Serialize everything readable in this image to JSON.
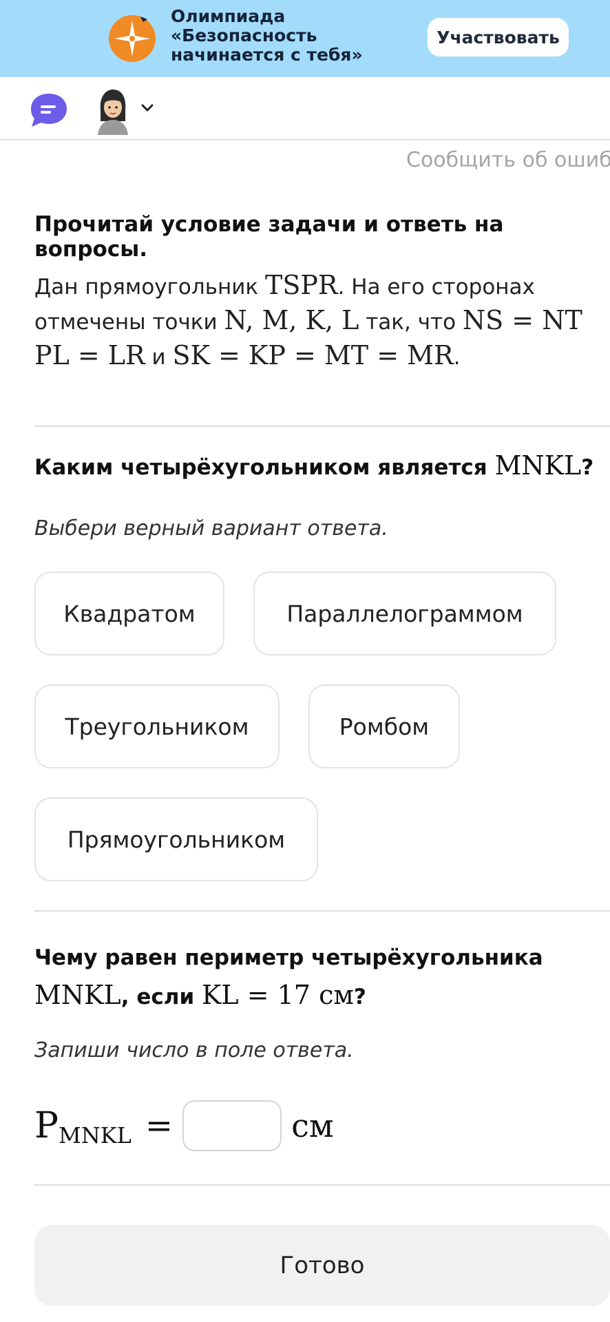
{
  "banner": {
    "title_lines": [
      "Олимпиада",
      "«Безопасность",
      "начинается с тебя»"
    ],
    "button_label": "Участвовать",
    "logo_icon": "compass-rose-icon",
    "colors": {
      "background": "#a3dcfa",
      "logo": "#f08a24"
    }
  },
  "topbar": {
    "chat_icon": "chat-bubble-icon",
    "avatar_icon": "user-avatar-icon",
    "chevron_icon": "chevron-down-icon",
    "accent": "#6c5ce7"
  },
  "report_error": "Сообщить об ошиб",
  "task": {
    "heading": "Прочитай условие задачи и ответь на вопросы.",
    "p1_text_a": "Дан прямоугольник ",
    "p1_math_a": "TSPR",
    "p1_text_b": ". На его сторонах",
    "p2_text_a": "отмечены точки ",
    "p2_math_a": "N, M, K, L",
    "p2_text_b": " так, что ",
    "p2_math_b": "NS = NT",
    "p3_math_a": "PL = LR",
    "p3_text_a": " и ",
    "p3_math_b": "SK = KP = MT = MR",
    "p3_text_b": "."
  },
  "q1": {
    "text": "Каким четырёхугольником является ",
    "math": "MNKL",
    "suffix": "?",
    "hint": "Выбери верный вариант ответа.",
    "options": [
      "Квадратом",
      "Параллелограммом",
      "Треугольником",
      "Ромбом",
      "Прямоугольником"
    ]
  },
  "q2": {
    "text_a": "Чему равен периметр четырёхугольника",
    "math_a": "MNKL",
    "text_b": ", если ",
    "math_b": "KL = 17",
    "math_unit": " см",
    "suffix": "?",
    "hint": "Запиши число в поле ответа.",
    "p_label": "P",
    "p_sub": "MNKL",
    "eq": "=",
    "unit": "см",
    "input_value": ""
  },
  "done_label": "Готово"
}
